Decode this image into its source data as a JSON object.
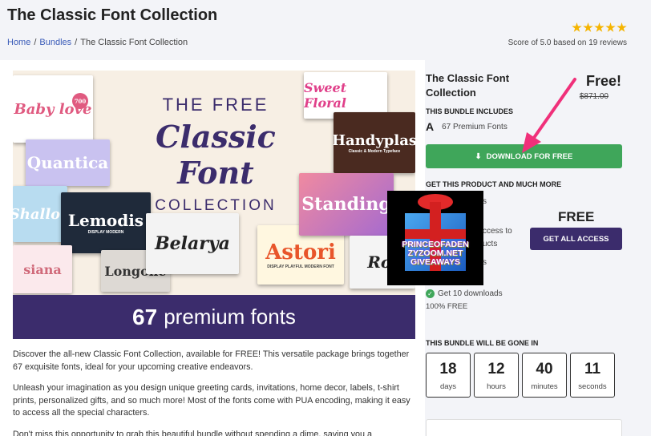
{
  "header": {
    "title": "The Classic Font Collection",
    "breadcrumb": [
      "Home",
      "Bundles",
      "The Classic Font Collection"
    ],
    "rating_stars": 5,
    "rating_text": "Score of 5.0 based on 19 reviews"
  },
  "hero": {
    "line1": "THE FREE",
    "line2": "Classic Font",
    "line3": "COLLECTION",
    "count": "67",
    "tagline": "premium fonts",
    "thumbs": {
      "baby_love": "Baby love",
      "badge": "700",
      "quantica": "Quantica",
      "shallon": "Shallon",
      "lemodis": "Lemodis",
      "lemodis_sub": "DISPLAY MODERN",
      "siana": "siana",
      "longone": "Longone",
      "belarya": "Belarya",
      "astori": "Astori",
      "astori_sub": "DISPLAY PLAYFUL MODERN FONT",
      "sweet": "Sweet Floral",
      "handyplas": "Handyplas",
      "handyplas_sub": "Classic & Modern Typeface",
      "standing": "Standing",
      "ro": "Rol"
    },
    "gift_label": "PRINCEOFADEN\nZYZOOM.NET\nGIVEAWAYS"
  },
  "description": [
    "Discover the all-new Classic Font Collection, available for FREE! This versatile package brings together 67 exquisite fonts, ideal for your upcoming creative endeavors.",
    "Unleash your imagination as you design unique greeting cards, invitations, home decor, labels, t-shirt prints, personalized gifts, and so much more! Most of the fonts come with PUA encoding, making it easy to access all the special characters.",
    "Don't miss this opportunity to grab this beautiful bundle without spending a dime, saving you a"
  ],
  "sidebar": {
    "title": "The Classic Font Collection",
    "price": "Free!",
    "old_price": "$871.00",
    "includes_heading": "THIS BUNDLE INCLUDES",
    "fonts_count": "67 Premium Fonts",
    "download_label": "DOWNLOAD FOR FREE",
    "more_heading": "GET THIS PRODUCT AND MUCH MORE",
    "partial_lines": [
      "s",
      "ccess to",
      "ucts",
      "s"
    ],
    "access_price": "FREE",
    "access_label": "GET ALL ACCESS",
    "downloads": "Get 10 downloads",
    "percent_free": "100% FREE",
    "gone_heading": "THIS BUNDLE WILL BE GONE IN",
    "timer": [
      {
        "value": "18",
        "unit": "days"
      },
      {
        "value": "12",
        "unit": "hours"
      },
      {
        "value": "40",
        "unit": "minutes"
      },
      {
        "value": "11",
        "unit": "seconds"
      }
    ]
  },
  "colors": {
    "accent_green": "#3fa65a",
    "accent_purple": "#3b2c6c",
    "star": "#f5b400",
    "arrow": "#f0307a"
  }
}
